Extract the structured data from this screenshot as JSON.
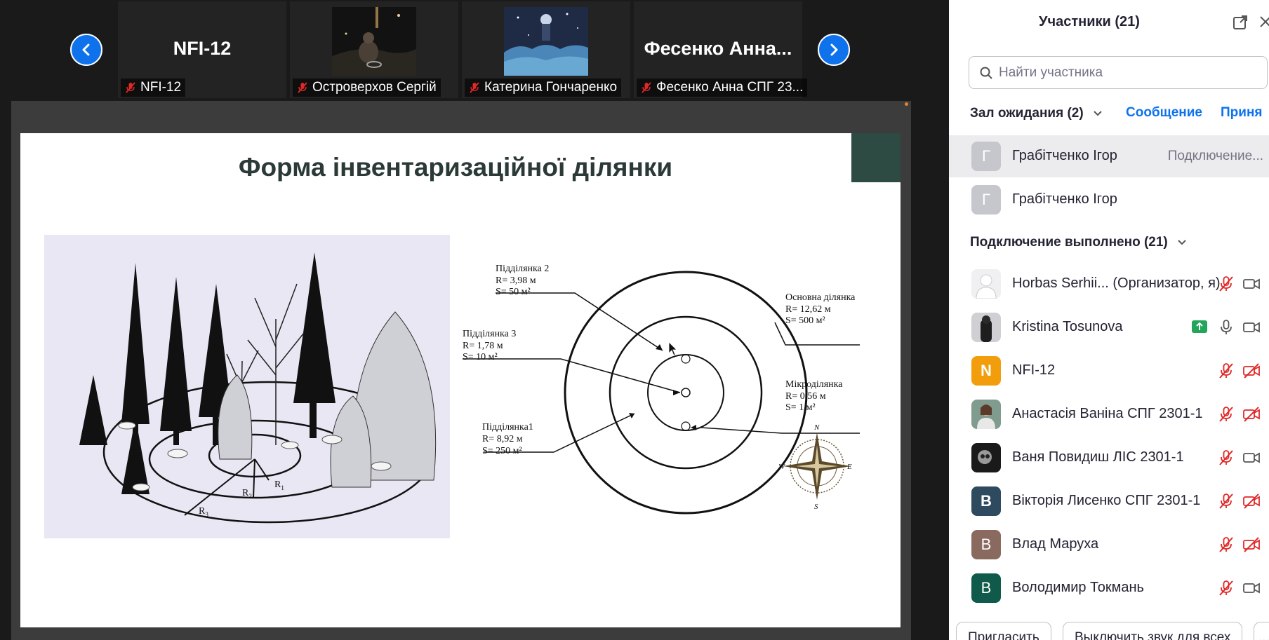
{
  "strip": {
    "tiles": [
      {
        "title": "NFI-12",
        "label": "NFI-12"
      },
      {
        "title": "",
        "label": "Островерхов Сергій"
      },
      {
        "title": "",
        "label": "Катерина Гончаренко"
      },
      {
        "title": "Фесенко  Анна...",
        "label": "Фесенко Анна СПГ 23..."
      }
    ]
  },
  "slide": {
    "title": "Форма інвентаризаційної ділянки",
    "forest_labels": {
      "r1": "R",
      "r1_sub": "1",
      "r2": "R",
      "r2_sub": "2",
      "r3": "R",
      "r3_sub": "3"
    },
    "plot2": {
      "name": "Підділянка 2",
      "radius": "R= 3,98 м",
      "area": "S= 50 м²"
    },
    "plot3": {
      "name": "Підділянка 3",
      "radius": "R= 1,78 м",
      "area": "S= 10 м²"
    },
    "plot1": {
      "name": "Підділянка1",
      "radius": "R= 8,92 м",
      "area": "S= 250 м²"
    },
    "main": {
      "name": "Основна ділянка",
      "radius": "R= 12,62 м",
      "area": "S= 500 м²"
    },
    "micro": {
      "name": "Мікроділянка",
      "radius": "R= 0,56 м",
      "area": "S= 1 м²"
    },
    "compass": {
      "n": "N",
      "s": "S",
      "e": "E",
      "w": "W"
    }
  },
  "panel": {
    "title": "Участники (21)",
    "search_placeholder": "Найти участника",
    "waiting_header": "Зал ожидания (2)",
    "message_btn": "Сообщение",
    "admit_btn": "Приня",
    "waiting": [
      {
        "initial": "Г",
        "name": "Грабітченко Ігор",
        "status": "Подключение..."
      },
      {
        "initial": "Г",
        "name": "Грабітченко Ігор",
        "status": ""
      }
    ],
    "connected_header": "Подключение выполнено (21)",
    "participants": [
      {
        "initial": "",
        "name": "Horbas Serhii... (Организатор, я)",
        "avatar": "user-silhouette",
        "color": "#e8e8ea"
      },
      {
        "initial": "",
        "name": "Kristina Tosunova",
        "avatar": "photo",
        "color": "#4a4a4a"
      },
      {
        "initial": "N",
        "name": "NFI-12",
        "avatar": "letter",
        "color": "#f19d0c"
      },
      {
        "initial": "",
        "name": "Анастасія Ваніна СПГ 2301-1",
        "avatar": "photo",
        "color": "#8aa69a"
      },
      {
        "initial": "",
        "name": "Ваня Повидиш ЛІС 2301-1",
        "avatar": "photo",
        "color": "#222222"
      },
      {
        "initial": "В",
        "name": "Вікторія Лисенко СПГ 2301-1",
        "avatar": "letter",
        "color": "#2e4a5e"
      },
      {
        "initial": "В",
        "name": "Влад Маруха",
        "avatar": "letter",
        "color": "#8a6a5e"
      },
      {
        "initial": "В",
        "name": "Володимир Токмань",
        "avatar": "letter",
        "color": "#0f5a4a"
      }
    ],
    "invite_btn": "Пригласить",
    "mute_all_btn": "Выключить звук для всех",
    "more_btn": "..."
  },
  "colors": {
    "accent": "#0e72ed",
    "muted": "#e02828",
    "share_green": "#23a55a"
  }
}
